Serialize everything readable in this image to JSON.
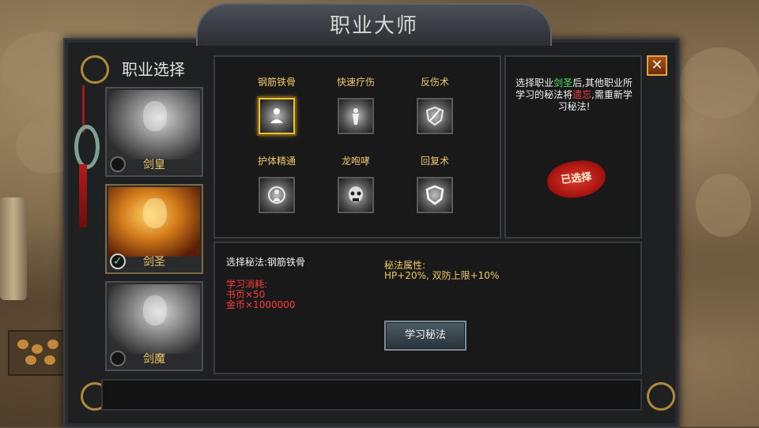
{
  "window": {
    "title": "职业大师"
  },
  "sidebar": {
    "title": "职业选择",
    "classes": [
      {
        "label": "剑皇",
        "selected": false
      },
      {
        "label": "剑圣",
        "selected": true
      },
      {
        "label": "剑魔",
        "selected": false
      }
    ]
  },
  "skills": [
    {
      "name": "钢筋铁骨",
      "icon": "meditation-icon",
      "active": true
    },
    {
      "name": "快速疗伤",
      "icon": "healing-figure-icon",
      "active": false
    },
    {
      "name": "反伤术",
      "icon": "reflect-shield-icon",
      "active": false
    },
    {
      "name": "护体精通",
      "icon": "body-guard-icon",
      "active": false
    },
    {
      "name": "龙咆哮",
      "icon": "skull-roar-icon",
      "active": false
    },
    {
      "name": "回复术",
      "icon": "shield-icon",
      "active": false
    }
  ],
  "hint": {
    "part1": "选择职业",
    "class_name": "剑圣",
    "part2": "后,其他职业所学习的秘法将",
    "forget": "遗忘",
    "part3": ",需重新学习秘法!"
  },
  "stamp": {
    "label": "已选择"
  },
  "detail": {
    "selected_label": "选择秘法:钢筋铁骨",
    "cost_title": "学习消耗:",
    "cost_pages": "书页×50",
    "cost_gold": "金币×1000000",
    "attr_title": "秘法属性:",
    "attr_value": "HP+20%, 双防上限+10%"
  },
  "learn_button": {
    "label": "学习秘法"
  },
  "close_button": {
    "glyph": "✕"
  },
  "colors": {
    "accent_gold": "#f0c766",
    "highlight_green": "#54e05a",
    "warning_red": "#ff3b3b"
  }
}
